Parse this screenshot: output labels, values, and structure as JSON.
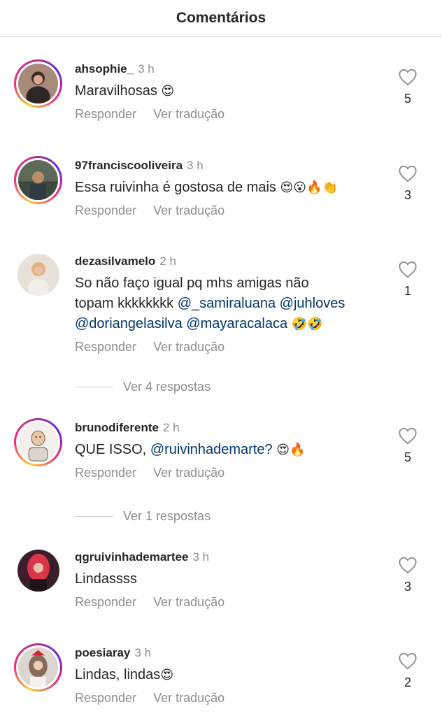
{
  "header": {
    "title": "Comentários"
  },
  "actions": {
    "reply": "Responder",
    "translate": "Ver tradução"
  },
  "comments": [
    {
      "user": "ahsophie_",
      "time": "3 h",
      "text": "Maravilhosas",
      "emoji": "😍",
      "likes": "5",
      "story_ring": true
    },
    {
      "user": "97franciscooliveira",
      "time": "3 h",
      "text": "Essa ruivinha é gostosa de mais",
      "emoji": "😍😮🔥👏",
      "likes": "3",
      "story_ring": true
    },
    {
      "user": "dezasilvamelo",
      "time": "2 h",
      "text_line1": "So não faço igual pq mhs amigas não",
      "text_line2": "topam kkkkkkkk",
      "mentions": [
        "@_samiraluana",
        "@juhloves",
        "@doriangelasilva",
        "@mayaracalaca"
      ],
      "emoji": "🤣🤣",
      "likes": "1",
      "story_ring": false,
      "view_replies": "Ver 4 respostas"
    },
    {
      "user": "brunodiferente",
      "time": "2 h",
      "text": "QUE ISSO,",
      "mention": "@ruivinhademarte?",
      "emoji": "😍🔥",
      "likes": "5",
      "story_ring": true,
      "view_replies": "Ver 1 respostas"
    },
    {
      "user": "qgruivinhademartee",
      "time": "3 h",
      "text": "Lindassss",
      "likes": "3",
      "story_ring": false
    },
    {
      "user": "poesiaray",
      "time": "3 h",
      "text": "Lindas, lindas",
      "emoji": "😍",
      "likes": "2",
      "story_ring": true
    }
  ],
  "colors": {
    "text": "#262626",
    "muted": "#8e8e8e",
    "mention": "#00376b",
    "divider": "#dbdbdb"
  },
  "icons": [
    "heart-outline-icon"
  ]
}
